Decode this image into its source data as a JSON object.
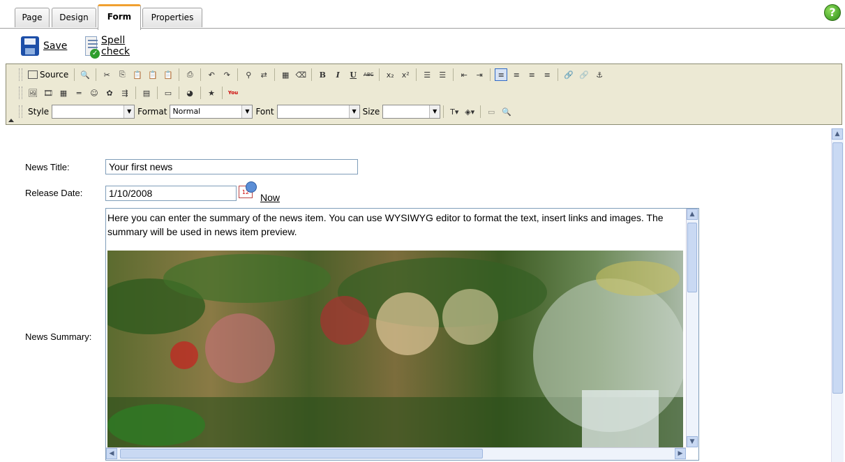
{
  "tabs": [
    {
      "label": "Page"
    },
    {
      "label": "Design"
    },
    {
      "label": "Form"
    },
    {
      "label": "Properties"
    }
  ],
  "help": {
    "glyph": "?"
  },
  "actions": {
    "save_label": "Save",
    "spell_label": "Spell check"
  },
  "toolbar": {
    "source_label": "Source",
    "style_label": "Style",
    "style_value": "",
    "format_label": "Format",
    "format_value": "Normal",
    "font_label": "Font",
    "font_value": "",
    "size_label": "Size",
    "size_value": "",
    "bold": "B",
    "italic": "I",
    "underline": "U",
    "strike": "ABC",
    "youtube": "You"
  },
  "form": {
    "title_label": "News Title:",
    "title_value": "Your first news",
    "date_label": "Release Date:",
    "date_value": "1/10/2008",
    "calendar_day": "12",
    "now_label": "Now",
    "summary_label": "News Summary:",
    "summary_text": "Here you can enter the summary of the news item. You can use WYSIWYG editor to format the text, insert links and images. The summary will be used in news item preview."
  }
}
